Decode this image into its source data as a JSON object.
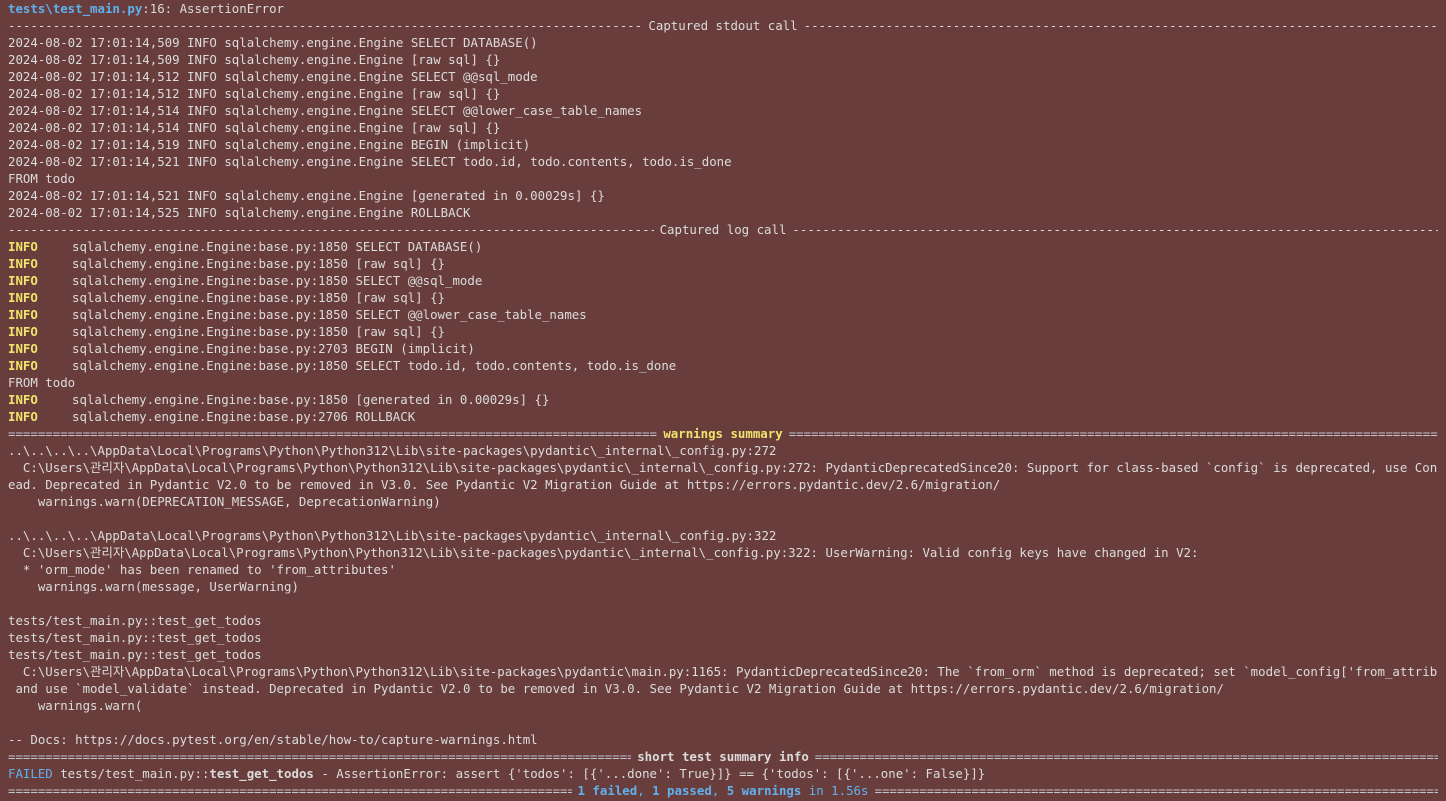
{
  "header": {
    "file": "tests\\test_main.py",
    "rest": ":16: AssertionError"
  },
  "stdout_section": {
    "title": "Captured stdout call",
    "lines": [
      "2024-08-02 17:01:14,509 INFO sqlalchemy.engine.Engine SELECT DATABASE()",
      "2024-08-02 17:01:14,509 INFO sqlalchemy.engine.Engine [raw sql] {}",
      "2024-08-02 17:01:14,512 INFO sqlalchemy.engine.Engine SELECT @@sql_mode",
      "2024-08-02 17:01:14,512 INFO sqlalchemy.engine.Engine [raw sql] {}",
      "2024-08-02 17:01:14,514 INFO sqlalchemy.engine.Engine SELECT @@lower_case_table_names",
      "2024-08-02 17:01:14,514 INFO sqlalchemy.engine.Engine [raw sql] {}",
      "2024-08-02 17:01:14,519 INFO sqlalchemy.engine.Engine BEGIN (implicit)",
      "2024-08-02 17:01:14,521 INFO sqlalchemy.engine.Engine SELECT todo.id, todo.contents, todo.is_done",
      "FROM todo",
      "2024-08-02 17:01:14,521 INFO sqlalchemy.engine.Engine [generated in 0.00029s] {}",
      "2024-08-02 17:01:14,525 INFO sqlalchemy.engine.Engine ROLLBACK"
    ]
  },
  "log_section": {
    "title": "Captured log call",
    "level_label": "INFO",
    "lines": [
      "sqlalchemy.engine.Engine:base.py:1850 SELECT DATABASE()",
      "sqlalchemy.engine.Engine:base.py:1850 [raw sql] {}",
      "sqlalchemy.engine.Engine:base.py:1850 SELECT @@sql_mode",
      "sqlalchemy.engine.Engine:base.py:1850 [raw sql] {}",
      "sqlalchemy.engine.Engine:base.py:1850 SELECT @@lower_case_table_names",
      "sqlalchemy.engine.Engine:base.py:1850 [raw sql] {}",
      "sqlalchemy.engine.Engine:base.py:2703 BEGIN (implicit)",
      "sqlalchemy.engine.Engine:base.py:1850 SELECT todo.id, todo.contents, todo.is_done"
    ],
    "from_line": "FROM todo",
    "lines_after": [
      "sqlalchemy.engine.Engine:base.py:1850 [generated in 0.00029s] {}",
      "sqlalchemy.engine.Engine:base.py:2706 ROLLBACK"
    ]
  },
  "warnings": {
    "title": "warnings summary",
    "w1": {
      "location": "..\\..\\..\\..\\AppData\\Local\\Programs\\Python\\Python312\\Lib\\site-packages\\pydantic\\_internal\\_config.py:272",
      "message": "  C:\\Users\\관리자\\AppData\\Local\\Programs\\Python\\Python312\\Lib\\site-packages\\pydantic\\_internal\\_config.py:272: PydanticDeprecatedSince20: Support for class-based `config` is deprecated, use ConfigDict inst",
      "message_cont": "ead. Deprecated in Pydantic V2.0 to be removed in V3.0. See Pydantic V2 Migration Guide at https://errors.pydantic.dev/2.6/migration/",
      "call": "    warnings.warn(DEPRECATION_MESSAGE, DeprecationWarning)"
    },
    "w2": {
      "location": "..\\..\\..\\..\\AppData\\Local\\Programs\\Python\\Python312\\Lib\\site-packages\\pydantic\\_internal\\_config.py:322",
      "message": "  C:\\Users\\관리자\\AppData\\Local\\Programs\\Python\\Python312\\Lib\\site-packages\\pydantic\\_internal\\_config.py:322: UserWarning: Valid config keys have changed in V2:",
      "bullet": "  * 'orm_mode' has been renamed to 'from_attributes'",
      "call": "    warnings.warn(message, UserWarning)"
    },
    "w3": {
      "tests": [
        "tests/test_main.py::test_get_todos",
        "tests/test_main.py::test_get_todos",
        "tests/test_main.py::test_get_todos"
      ],
      "message": "  C:\\Users\\관리자\\AppData\\Local\\Programs\\Python\\Python312\\Lib\\site-packages\\pydantic\\main.py:1165: PydanticDeprecatedSince20: The `from_orm` method is deprecated; set `model_config['from_attributes']=True`",
      "message_cont": " and use `model_validate` instead. Deprecated in Pydantic V2.0 to be removed in V3.0. See Pydantic V2 Migration Guide at https://errors.pydantic.dev/2.6/migration/",
      "call": "    warnings.warn("
    },
    "docs": "-- Docs: https://docs.pytest.org/en/stable/how-to/capture-warnings.html"
  },
  "summary": {
    "title": "short test summary info",
    "failed_label": "FAILED",
    "failed_path": " tests/test_main.py::",
    "failed_test": "test_get_todos",
    "failed_msg": " - AssertionError: assert {'todos': [{'...done': True}]} == {'todos': [{'...one': False}]}"
  },
  "final": {
    "failed": "1 failed",
    "sep1": ", ",
    "passed": "1 passed",
    "sep2": ", ",
    "warnings": "5 warnings",
    "time": " in 1.56s"
  },
  "colors": {
    "background": "#683d3c",
    "text": "#dcdcdc",
    "info": "#f0e46b",
    "accent_blue": "#5fb1ee",
    "failed_red": "#e8545c",
    "passed_green": "#6acb63"
  }
}
